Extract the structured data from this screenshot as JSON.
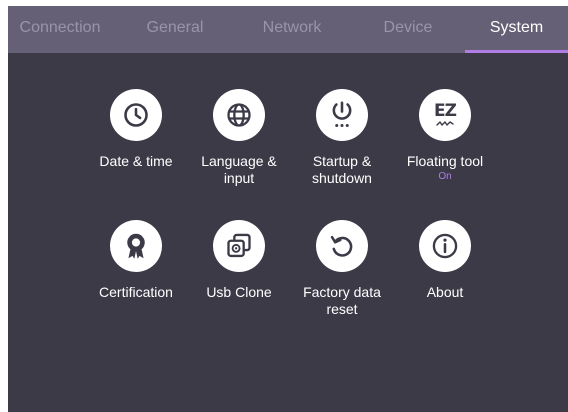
{
  "tabs": [
    {
      "label": "Connection",
      "active": false
    },
    {
      "label": "General",
      "active": false
    },
    {
      "label": "Network",
      "active": false
    },
    {
      "label": "Device",
      "active": false
    },
    {
      "label": "System",
      "active": true
    }
  ],
  "colors": {
    "background": "#3d3a48",
    "tabbar": "#656075",
    "accent": "#b07ce6",
    "inactive_tab_text": "#9a94aa",
    "icon_circle": "#ffffff"
  },
  "items": [
    {
      "label": "Date & time",
      "icon": "clock-icon"
    },
    {
      "label": "Language &\ninput",
      "icon": "globe-icon"
    },
    {
      "label": "Startup &\nshutdown",
      "icon": "power-icon"
    },
    {
      "label": "Floating tool",
      "icon": "ez-icon",
      "icon_text": "EZ",
      "status": "On"
    },
    {
      "label": "Certification",
      "icon": "award-ribbon-icon"
    },
    {
      "label": "Usb Clone",
      "icon": "clone-icon"
    },
    {
      "label": "Factory data\nreset",
      "icon": "reset-icon"
    },
    {
      "label": "About",
      "icon": "info-icon"
    }
  ]
}
